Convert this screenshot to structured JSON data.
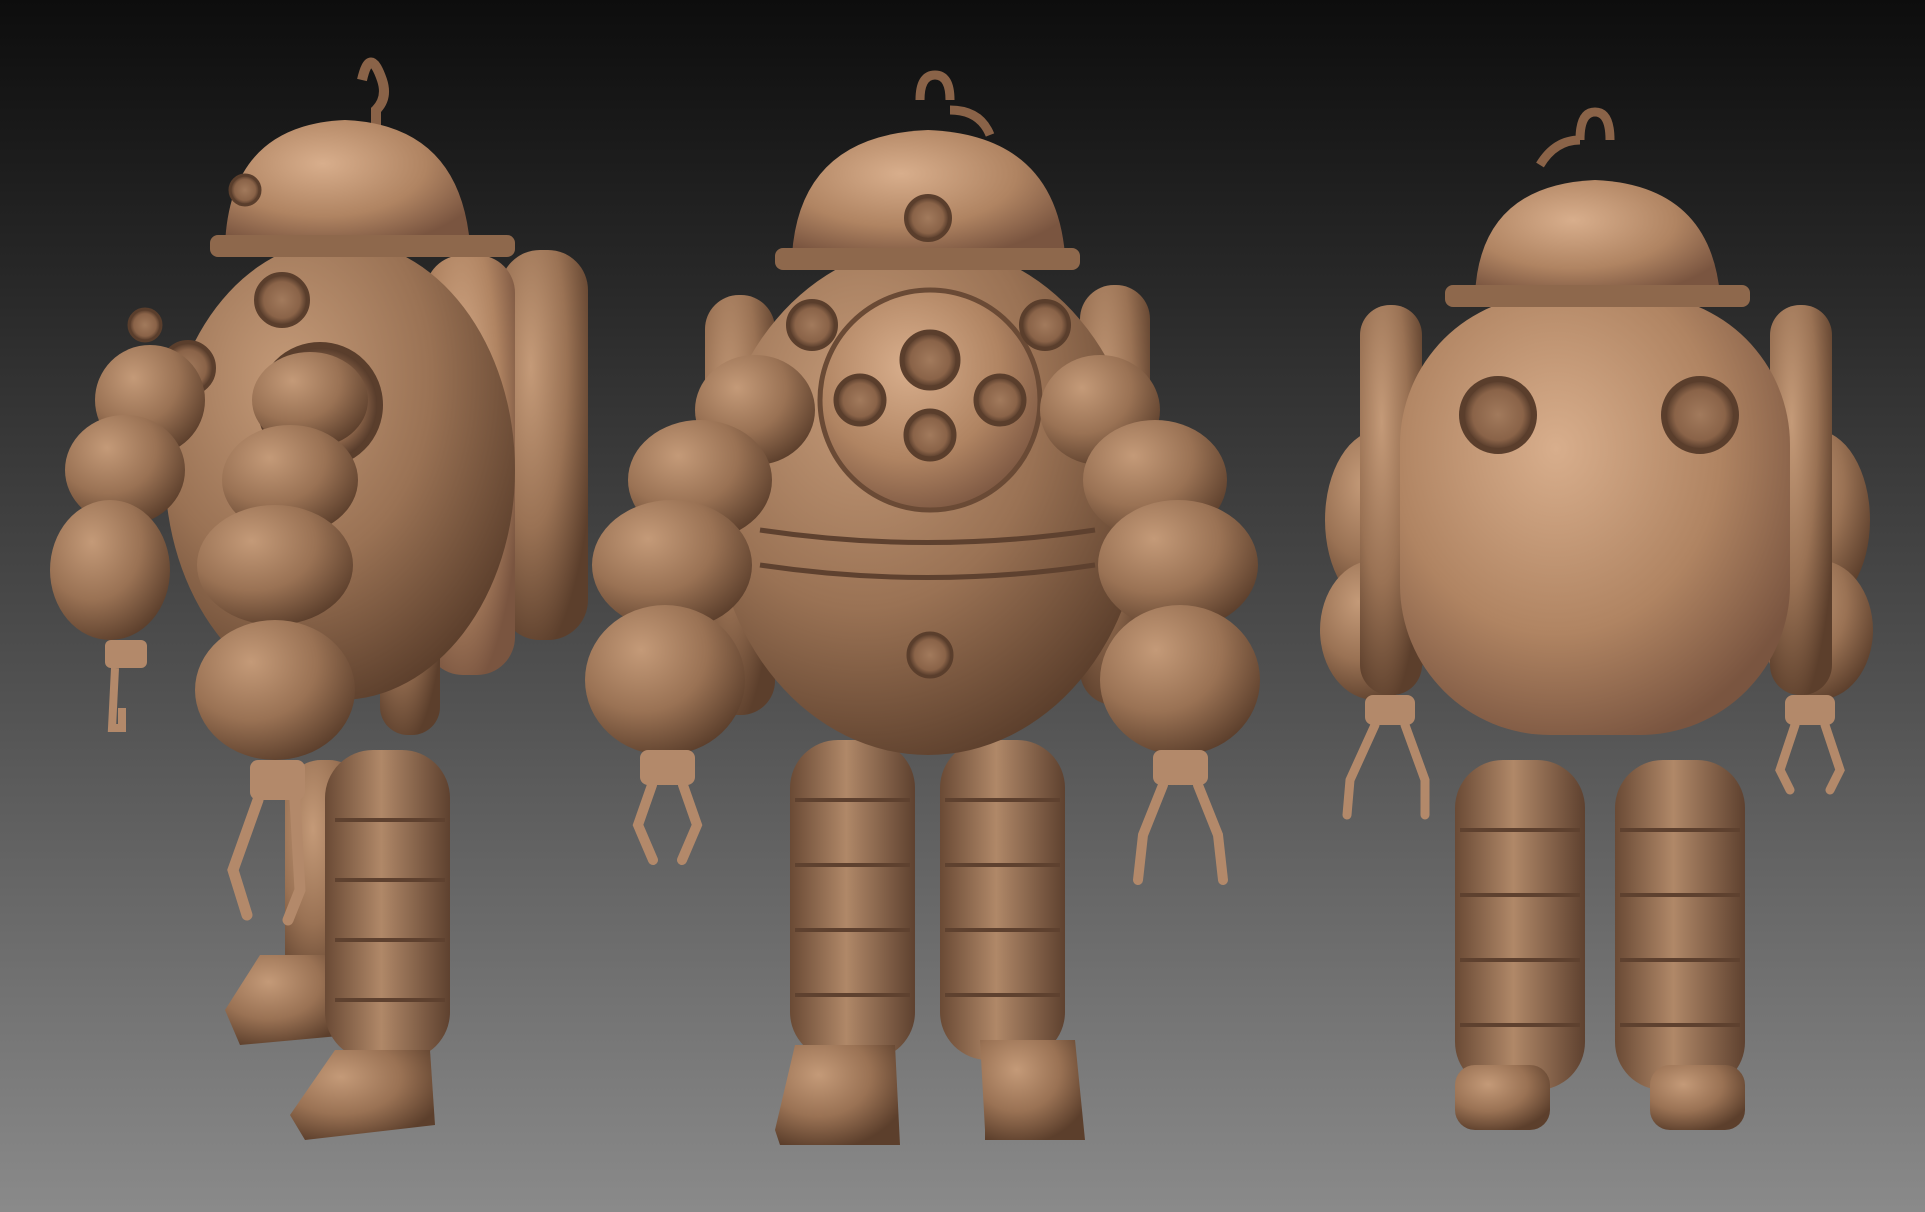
{
  "scene": {
    "background": {
      "top_color": "#0d0d0d",
      "bottom_color": "#8a8a8a"
    },
    "material_color": "#9c7558",
    "views": [
      {
        "name": "three-quarter-view"
      },
      {
        "name": "front-view"
      },
      {
        "name": "back-view"
      }
    ]
  }
}
